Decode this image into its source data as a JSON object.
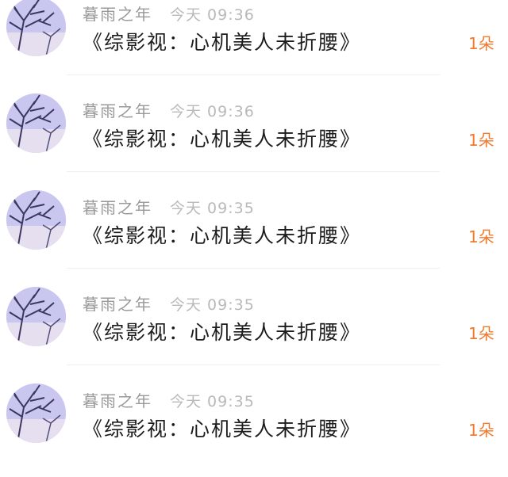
{
  "messages": [
    {
      "sender": "暮雨之年",
      "time": "今天 09:36",
      "text": "《综影视：心机美人未折腰》",
      "gift": "1朵"
    },
    {
      "sender": "暮雨之年",
      "time": "今天 09:36",
      "text": "《综影视：心机美人未折腰》",
      "gift": "1朵"
    },
    {
      "sender": "暮雨之年",
      "time": "今天 09:35",
      "text": "《综影视：心机美人未折腰》",
      "gift": "1朵"
    },
    {
      "sender": "暮雨之年",
      "time": "今天 09:35",
      "text": "《综影视：心机美人未折腰》",
      "gift": "1朵"
    },
    {
      "sender": "暮雨之年",
      "time": "今天 09:35",
      "text": "《综影视：心机美人未折腰》",
      "gift": "1朵"
    }
  ],
  "colors": {
    "sender": "#9a9a9a",
    "time": "#b9b9b9",
    "message": "#1c1c1c",
    "gift": "#f07a2e",
    "avatar_sky": "#c9c7f0",
    "avatar_branches": "#3b3860"
  },
  "icons": {
    "avatar": "winter-tree-avatar-icon"
  }
}
